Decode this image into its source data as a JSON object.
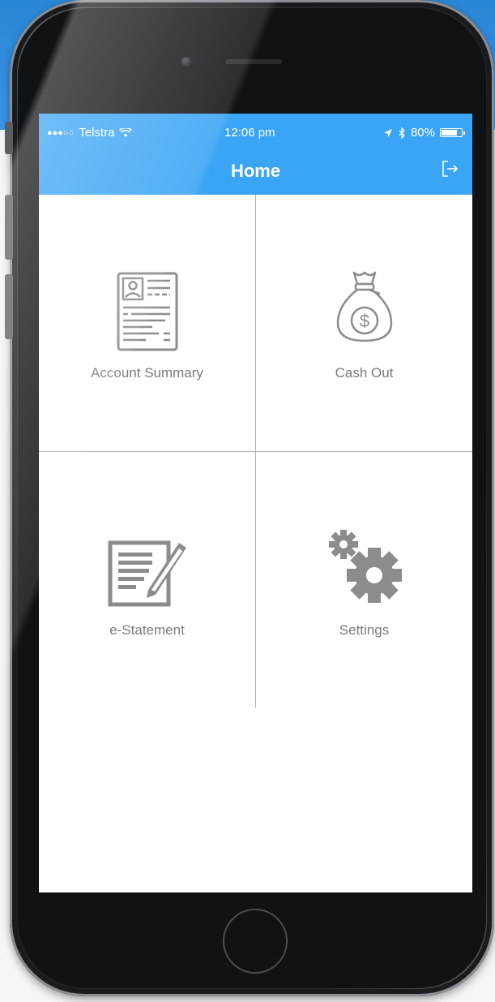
{
  "status_bar": {
    "carrier": "Telstra",
    "time": "12:06 pm",
    "battery": "80%",
    "battery_level": 0.8
  },
  "nav": {
    "title": "Home"
  },
  "tiles": [
    {
      "label": "Account Summary",
      "icon": "account-summary-icon"
    },
    {
      "label": "Cash Out",
      "icon": "money-bag-icon"
    },
    {
      "label": "e-Statement",
      "icon": "statement-pen-icon"
    },
    {
      "label": "Settings",
      "icon": "gears-icon"
    }
  ],
  "colors": {
    "header_blue": "#3aa4f5",
    "icon_gray": "#8c8c8c",
    "label_gray": "#7a7a7a",
    "divider_gray": "#aeaeae"
  }
}
